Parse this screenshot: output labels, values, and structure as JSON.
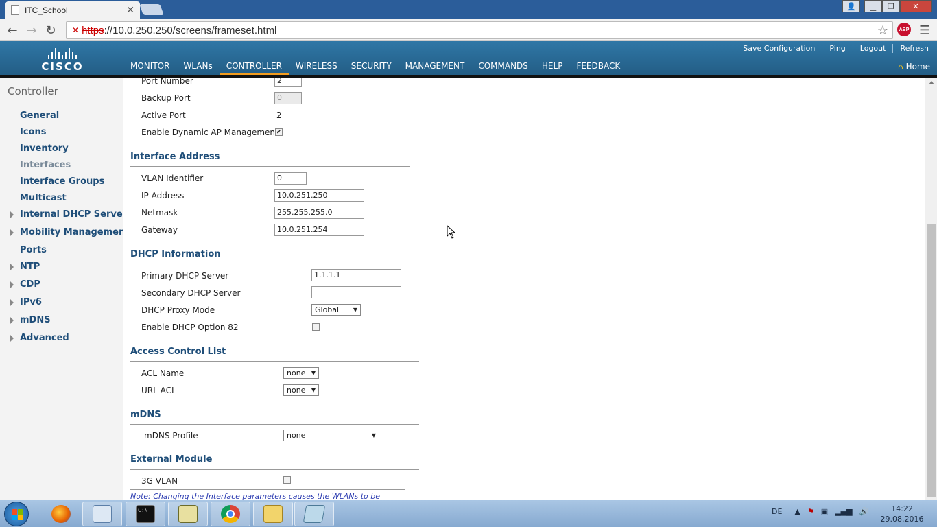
{
  "browser": {
    "tab_title": "ITC_School",
    "tab_close": "✕",
    "url_scheme": "https",
    "url_rest": "://10.0.250.250/screens/frameset.html",
    "abp_label": "ABP",
    "minimize": "▁",
    "maximize": "❐",
    "close": "✕"
  },
  "header": {
    "logo_text": "CISCO",
    "nav": [
      "MONITOR",
      "WLANs",
      "CONTROLLER",
      "WIRELESS",
      "SECURITY",
      "MANAGEMENT",
      "COMMANDS",
      "HELP",
      "FEEDBACK"
    ],
    "active_nav": "CONTROLLER",
    "links": [
      "Save Configuration",
      "Ping",
      "Logout",
      "Refresh"
    ],
    "home": "Home"
  },
  "sidebar": {
    "title": "Controller",
    "items": [
      {
        "label": "General",
        "expandable": false
      },
      {
        "label": "Icons",
        "expandable": false
      },
      {
        "label": "Inventory",
        "expandable": false
      },
      {
        "label": "Interfaces",
        "expandable": false,
        "current": true
      },
      {
        "label": "Interface Groups",
        "expandable": false
      },
      {
        "label": "Multicast",
        "expandable": false
      },
      {
        "label": "Internal DHCP Server",
        "expandable": true
      },
      {
        "label": "Mobility Management",
        "expandable": true
      },
      {
        "label": "Ports",
        "expandable": false
      },
      {
        "label": "NTP",
        "expandable": true
      },
      {
        "label": "CDP",
        "expandable": true
      },
      {
        "label": "IPv6",
        "expandable": true
      },
      {
        "label": "mDNS",
        "expandable": true
      },
      {
        "label": "Advanced",
        "expandable": true
      }
    ]
  },
  "port": {
    "port_number_label": "Port Number",
    "port_number_value": "2",
    "backup_port_label": "Backup Port",
    "backup_port_value": "0",
    "active_port_label": "Active Port",
    "active_port_value": "2",
    "dynamic_ap_label": "Enable Dynamic AP Management",
    "dynamic_ap_checked": "✔"
  },
  "interface_address": {
    "title": "Interface Address",
    "vlan_label": "VLAN Identifier",
    "vlan_value": "0",
    "ip_label": "IP Address",
    "ip_value": "10.0.251.250",
    "netmask_label": "Netmask",
    "netmask_value": "255.255.255.0",
    "gateway_label": "Gateway",
    "gateway_value": "10.0.251.254"
  },
  "dhcp": {
    "title": "DHCP Information",
    "primary_label": "Primary DHCP Server",
    "primary_value": "1.1.1.1",
    "secondary_label": "Secondary DHCP Server",
    "secondary_value": "",
    "proxy_label": "DHCP Proxy Mode",
    "proxy_value": "Global",
    "option82_label": "Enable DHCP Option 82"
  },
  "acl": {
    "title": "Access Control List",
    "acl_name_label": "ACL Name",
    "acl_name_value": "none",
    "url_acl_label": "URL ACL",
    "url_acl_value": "none"
  },
  "mdns": {
    "title": "mDNS",
    "profile_label": "mDNS Profile",
    "profile_value": "none"
  },
  "external": {
    "title": "External Module",
    "vlan3g_label": "3G VLAN"
  },
  "note": "Note: Changing the Interface parameters causes the WLANs to be",
  "taskbar": {
    "lang": "DE",
    "time": "14:22",
    "date": "29.08.2016"
  },
  "colors": {
    "cisco_blue": "#2a6b96",
    "nav_active": "#f39c1e",
    "link_blue": "#1f4e79"
  }
}
